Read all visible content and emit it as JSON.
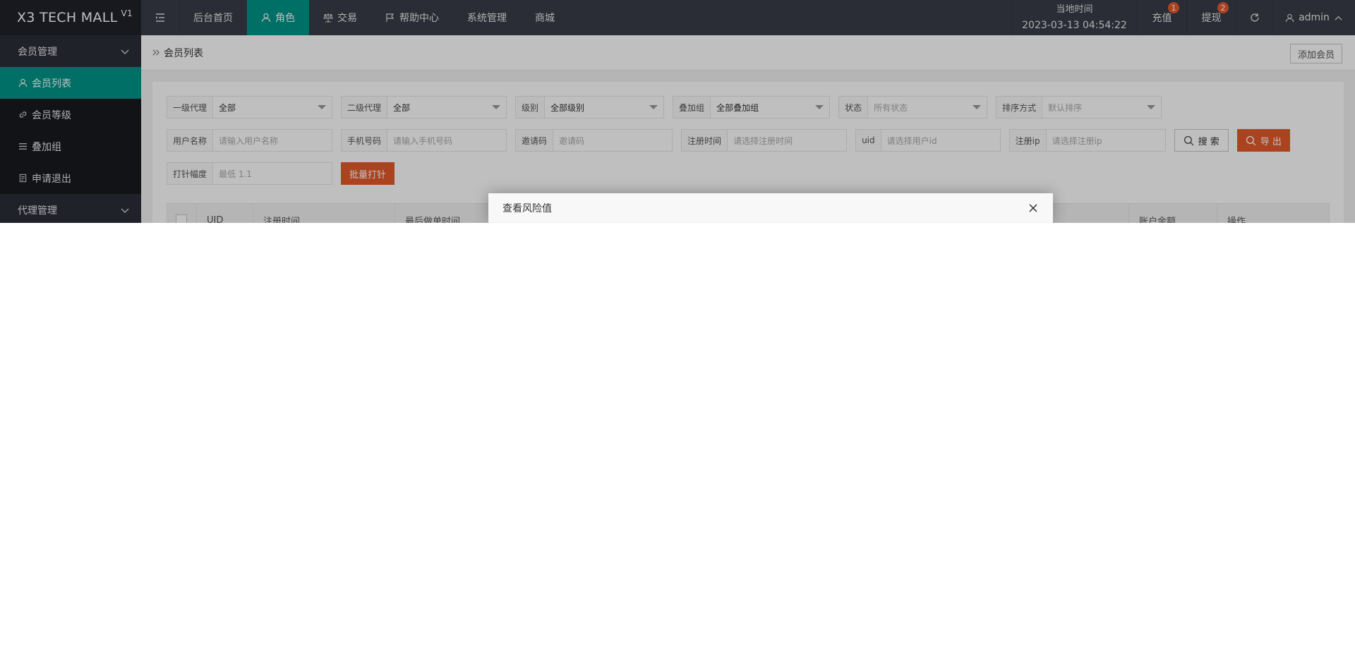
{
  "brand": {
    "title": "X3 TECH MALL",
    "version": "V1"
  },
  "nav": {
    "items": [
      {
        "label": "后台首页",
        "active": false,
        "icon": ""
      },
      {
        "label": "角色",
        "active": true,
        "icon": "user-icon"
      },
      {
        "label": "交易",
        "active": false,
        "icon": "scale-icon"
      },
      {
        "label": "帮助中心",
        "active": false,
        "icon": "flag-icon"
      },
      {
        "label": "系统管理",
        "active": false,
        "icon": ""
      },
      {
        "label": "商城",
        "active": false,
        "icon": ""
      }
    ]
  },
  "header": {
    "time_label": "当地时间",
    "time_value": "2023-03-13 04:54:22",
    "recharge_label": "充值",
    "recharge_badge": "1",
    "withdraw_label": "提现",
    "withdraw_badge": "2",
    "user_label": "admin"
  },
  "sidebar": {
    "group1": "会员管理",
    "items": [
      {
        "label": "会员列表",
        "active": true,
        "icon": "user-icon"
      },
      {
        "label": "会员等级",
        "active": false,
        "icon": "link-icon"
      },
      {
        "label": "叠加组",
        "active": false,
        "icon": "list-icon"
      },
      {
        "label": "申请退出",
        "active": false,
        "icon": "document-icon"
      }
    ],
    "group2": "代理管理"
  },
  "breadcrumb": {
    "current": "会员列表",
    "add_button": "添加会员"
  },
  "filters": {
    "row1": [
      {
        "label": "一级代理",
        "value": "全部",
        "placeholder": false
      },
      {
        "label": "二级代理",
        "value": "全部",
        "placeholder": false
      },
      {
        "label": "级别",
        "value": "全部级别",
        "placeholder": false
      },
      {
        "label": "叠加组",
        "value": "全部叠加组",
        "placeholder": false
      },
      {
        "label": "状态",
        "value": "所有状态",
        "placeholder": true
      },
      {
        "label": "排序方式",
        "value": "默认排序",
        "placeholder": true
      }
    ],
    "row2": [
      {
        "label": "用户名称",
        "value": "请输入用户名称"
      },
      {
        "label": "手机号码",
        "value": "请输入手机号码"
      },
      {
        "label": "邀请码",
        "value": "邀请码"
      },
      {
        "label": "注册时间",
        "value": "请选择注册时间"
      },
      {
        "label": "uid",
        "value": "请选择用户id"
      },
      {
        "label": "注册ip",
        "value": "请选择注册ip"
      }
    ],
    "search_button": "搜 索",
    "export_button": "导 出",
    "row3": {
      "label": "打针幅度",
      "value": "最低 1.1"
    },
    "batch_button": "批量打针"
  },
  "table": {
    "headers": [
      "UID",
      "注册时间",
      "最后做单时间",
      "账户余额",
      "操作"
    ]
  },
  "modal": {
    "title": "查看风险值"
  }
}
